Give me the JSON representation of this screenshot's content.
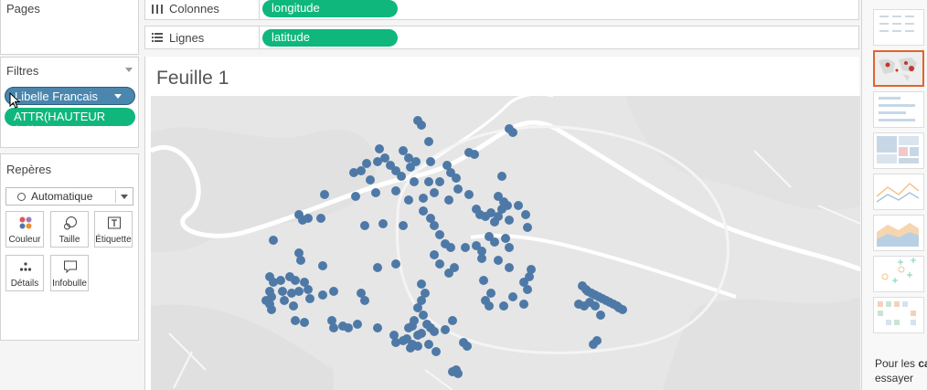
{
  "left_panel": {
    "pages_title": "Pages",
    "filters_title": "Filtres",
    "filters": [
      {
        "label": "Libelle Francais"
      },
      {
        "label": "ATTR(HAUTEUR (m))"
      }
    ],
    "marks_title": "Repères",
    "mark_type": "Automatique",
    "mark_buttons": [
      {
        "label": "Couleur",
        "icon": "color-icon"
      },
      {
        "label": "Taille",
        "icon": "size-icon"
      },
      {
        "label": "Étiquette",
        "icon": "label-icon"
      },
      {
        "label": "Détails",
        "icon": "detail-icon"
      },
      {
        "label": "Infobulle",
        "icon": "tooltip-icon"
      }
    ]
  },
  "shelves": {
    "columns_label": "Colonnes",
    "columns_pill": "longitude",
    "rows_label": "Lignes",
    "rows_pill": "latitude"
  },
  "sheet": {
    "title": "Feuille 1"
  },
  "map": {
    "point_color": "#4e79a7"
  },
  "show_me": {
    "text_prefix": "Pour les ",
    "text_bold": "ca",
    "text_line2": "essayer",
    "selected_thumb": "map"
  },
  "colors": {
    "accent_green": "#0fb77d",
    "filter_blue": "#4a86ad",
    "selected_border": "#e2632e"
  }
}
